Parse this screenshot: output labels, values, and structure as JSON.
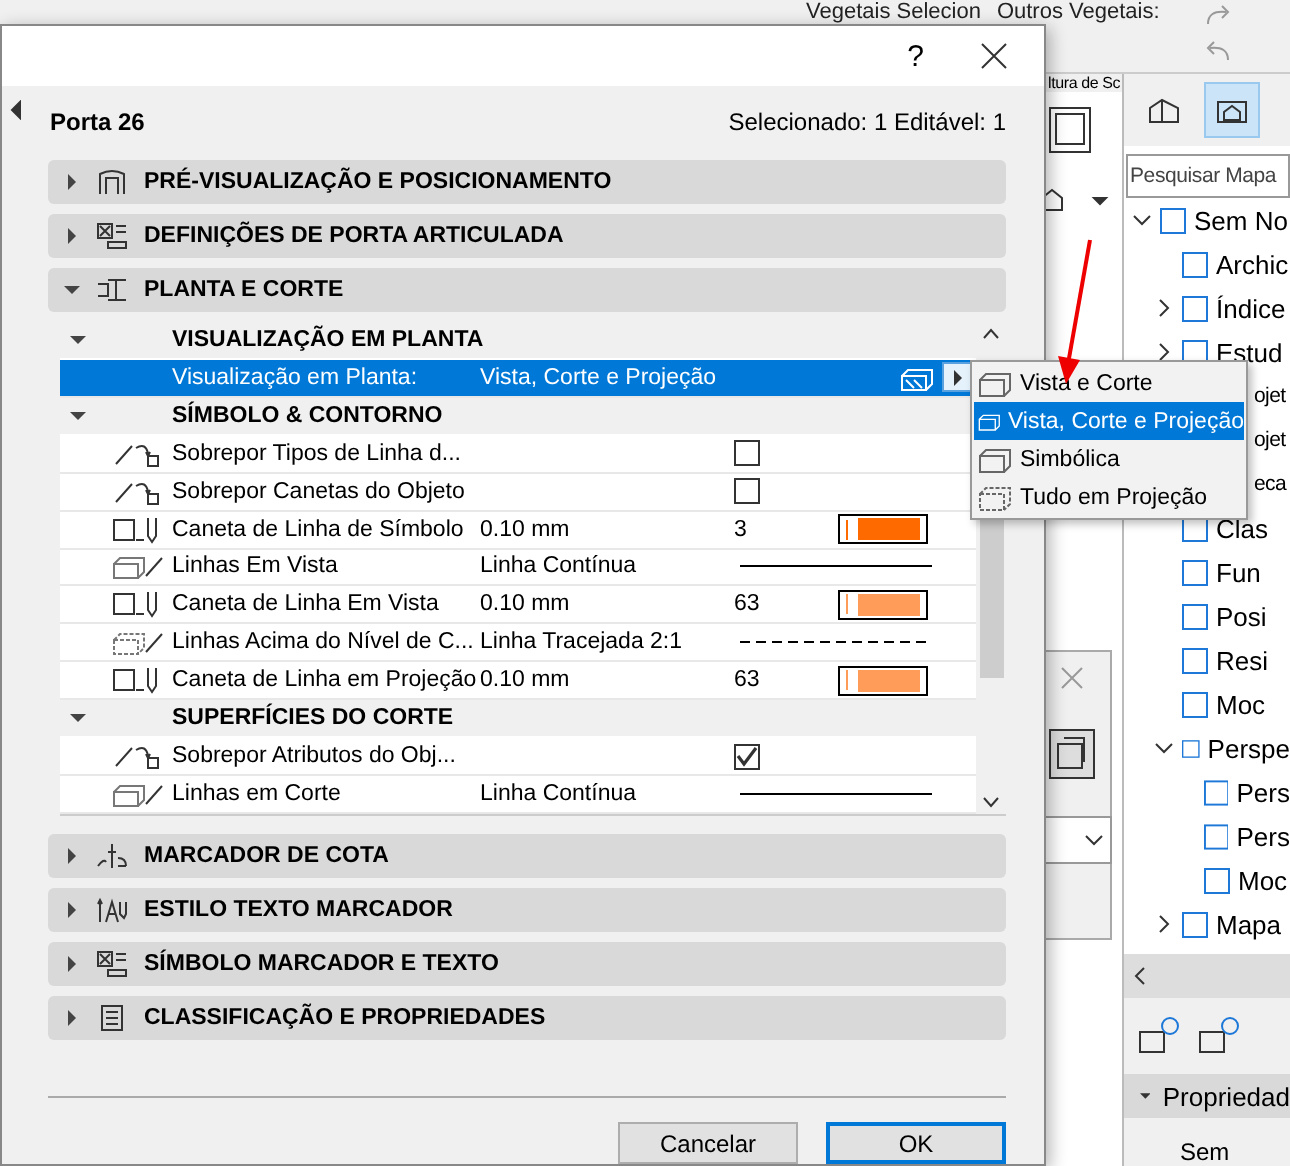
{
  "background_app": {
    "toolbar_labels": [
      "Vegetais Selecion",
      "Outros Vegetais:"
    ],
    "side_label": "ltura de Sc",
    "navigator": {
      "search": {
        "placeholder": "Pesquisar Mapa"
      },
      "tree": [
        {
          "label": "Sem No",
          "expanded": true,
          "children": [
            {
              "label": "Archic"
            },
            {
              "label": "Índice",
              "expanded": false
            },
            {
              "label": "Estud",
              "expanded": false
            },
            {
              "label": "ojet",
              "kind": "covered"
            },
            {
              "label": "ojet",
              "kind": "covered"
            },
            {
              "label": "eca",
              "kind": "covered"
            },
            {
              "label": "Clas"
            },
            {
              "label": "Fun"
            },
            {
              "label": "Posi"
            },
            {
              "label": "Resi"
            },
            {
              "label": "Moc"
            },
            {
              "label": "Perspe",
              "expanded": true,
              "children": [
                {
                  "label": "Pers"
                },
                {
                  "label": "Pers"
                },
                {
                  "label": "Moc"
                }
              ]
            },
            {
              "label": "Mapa",
              "expanded": false
            }
          ]
        }
      ]
    },
    "properties": {
      "title": "Propriedad",
      "expanded": true,
      "text": "Sem"
    }
  },
  "dialog": {
    "help": "?",
    "element_name": "Porta 26",
    "selection_info": "Selecionado: 1 Editável: 1",
    "sections_before": [
      {
        "title": "PRÉ-VISUALIZAÇÃO E POSICIONAMENTO",
        "expanded": false
      },
      {
        "title": "DEFINIÇÕES DE PORTA ARTICULADA",
        "expanded": false
      },
      {
        "title": "PLANTA E CORTE",
        "expanded": true
      }
    ],
    "groups": [
      {
        "title": "VISUALIZAÇÃO EM PLANTA",
        "expanded": true,
        "rows": [
          {
            "kind": "option",
            "label": "Visualização em Planta:",
            "value": "Vista, Corte e Projeção",
            "selected": true
          }
        ]
      },
      {
        "title": "SÍMBOLO & CONTORNO",
        "expanded": true,
        "rows": [
          {
            "kind": "checkbox",
            "label": "Sobrepor Tipos de Linha d...",
            "checked": false,
            "selected": false
          },
          {
            "kind": "checkbox",
            "label": "Sobrepor Canetas do Objeto",
            "checked": false,
            "selected": false
          },
          {
            "kind": "pen",
            "label": "Caneta de Linha de Símbolo",
            "value": "0.10 mm",
            "number": "3",
            "color": "#ff6a00",
            "selected": false
          },
          {
            "kind": "line",
            "label": "Linhas Em Vista",
            "value": "Linha Contínua",
            "dashed": false,
            "selected": false
          },
          {
            "kind": "pen",
            "label": "Caneta de Linha Em Vista",
            "value": "0.10 mm",
            "number": "63",
            "color": "#ff9c5a",
            "selected": false
          },
          {
            "kind": "line",
            "label": "Linhas Acima do Nível de C...",
            "value": "Linha Tracejada 2:1",
            "dashed": true,
            "selected": false
          },
          {
            "kind": "pen",
            "label": "Caneta de Linha em Projeção",
            "value": "0.10 mm",
            "number": "63",
            "color": "#ff9c5a",
            "selected": false
          }
        ]
      },
      {
        "title": "SUPERFÍCIES DO CORTE",
        "expanded": true,
        "rows": [
          {
            "kind": "checkbox",
            "label": "Sobrepor Atributos do Obj...",
            "checked": true,
            "selected": false
          },
          {
            "kind": "line",
            "label": "Linhas em Corte",
            "value": "Linha Contínua",
            "dashed": false,
            "selected": false
          }
        ]
      }
    ],
    "sections_after": [
      {
        "title": "MARCADOR DE COTA",
        "expanded": false
      },
      {
        "title": "ESTILO TEXTO MARCADOR",
        "expanded": false
      },
      {
        "title": "SÍMBOLO MARCADOR E TEXTO",
        "expanded": false
      },
      {
        "title": "CLASSIFICAÇÃO E PROPRIEDADES",
        "expanded": false
      }
    ],
    "menu": [
      {
        "label": "Vista e Corte",
        "selected": false
      },
      {
        "label": "Vista, Corte e Projeção",
        "selected": true
      },
      {
        "label": "Simbólica",
        "selected": false
      },
      {
        "label": "Tudo em Projeção",
        "selected": false
      }
    ],
    "buttons": [
      {
        "label": "Cancelar",
        "default": false
      },
      {
        "label": "OK",
        "default": true
      }
    ]
  }
}
